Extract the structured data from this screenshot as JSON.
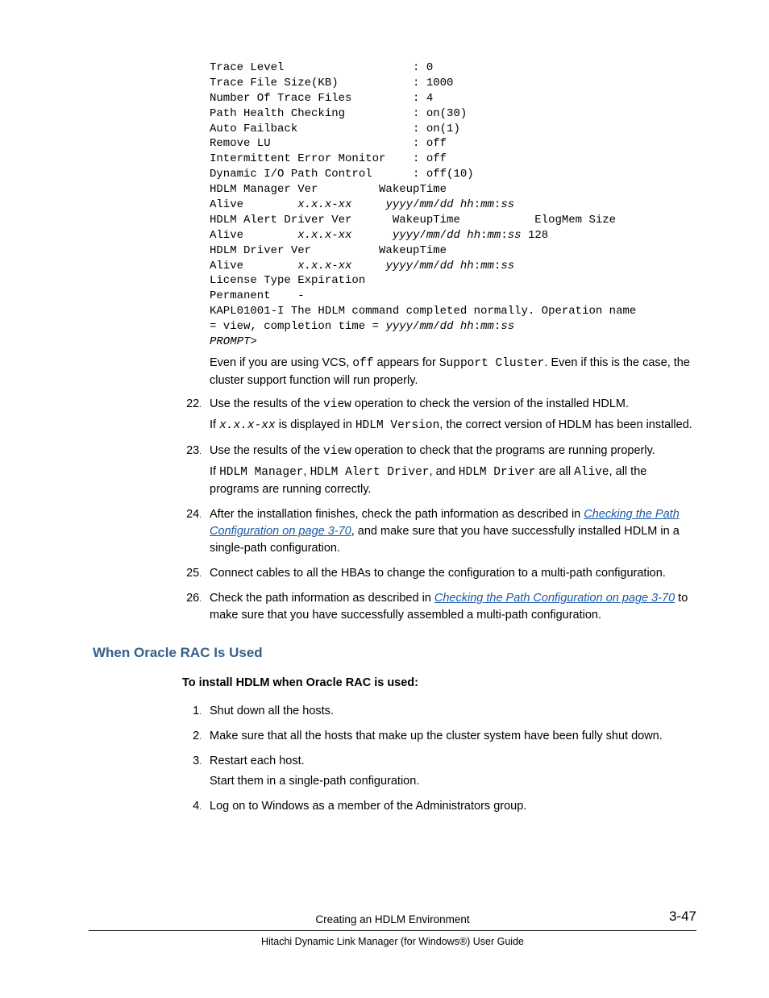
{
  "code": {
    "k0": "Trace Level                   : ",
    "v0": "0",
    "k1": "Trace File Size(KB)           : ",
    "v1": "1000",
    "k2": "Number Of Trace Files         : ",
    "v2": "4",
    "k3": "Path Health Checking          : ",
    "v3": "on(30)",
    "k4": "Auto Failback                 : ",
    "v4": "on(1)",
    "k5": "Remove LU                     : ",
    "v5": "off",
    "k6": "Intermittent Error Monitor    : ",
    "v6": "off",
    "k7": "Dynamic I/O Path Control      : ",
    "v7": "off(10)",
    "l8": "HDLM Manager Ver         WakeupTime",
    "a9a": "Alive        ",
    "a9b": "x.x.x-xx",
    "a9c": "     ",
    "a9d": "yyyy",
    "a9e": "/",
    "a9f": "mm",
    "a9g": "/",
    "a9h": "dd hh",
    "a9i": ":",
    "a9j": "mm",
    "a9k": ":",
    "a9l": "ss",
    "l10": "HDLM Alert Driver Ver      WakeupTime           ElogMem Size",
    "a11a": "Alive        ",
    "a11b": "x.x.x-xx",
    "a11c": "      ",
    "a11d": "yyyy",
    "a11e": "/",
    "a11f": "mm",
    "a11g": "/",
    "a11h": "dd hh",
    "a11i": ":",
    "a11j": "mm",
    "a11k": ":",
    "a11l": "ss",
    "a11m": " 128",
    "l12": "HDLM Driver Ver          WakeupTime",
    "a13a": "Alive        ",
    "a13b": "x.x.x-xx",
    "a13c": "     ",
    "a13d": "yyyy",
    "a13e": "/",
    "a13f": "mm",
    "a13g": "/",
    "a13h": "dd hh",
    "a13i": ":",
    "a13j": "mm",
    "a13k": ":",
    "a13l": "ss",
    "l14": "License Type Expiration",
    "l15": "Permanent    -",
    "l16a": "KAPL01001-I The HDLM command completed normally. Operation name ",
    "l16b": "= view, completion time = ",
    "l16c": "yyyy",
    "l16d": "/",
    "l16e": "mm",
    "l16f": "/",
    "l16g": "dd hh",
    "l16h": ":",
    "l16i": "mm",
    "l16j": ":",
    "l16k": "ss",
    "l17": "PROMPT",
    "l17b": ">"
  },
  "p_cluster_a": "Even if you are using VCS, ",
  "p_cluster_b": "off",
  "p_cluster_c": " appears for ",
  "p_cluster_d": "Support Cluster",
  "p_cluster_e": ". Even if this is the case, the cluster support function will run properly.",
  "steps": {
    "n22": "22",
    "s22a": "Use the results of the ",
    "s22b": "view",
    "s22c": " operation to check the version of the installed HDLM.",
    "s22d": "If ",
    "s22e": "x.x.x-xx",
    "s22f": " is displayed in ",
    "s22g": "HDLM Version",
    "s22h": ", the correct version of HDLM has been installed.",
    "n23": "23",
    "s23a": "Use the results of the ",
    "s23b": "view",
    "s23c": " operation to check that the programs are running properly.",
    "s23d": "If ",
    "s23e": "HDLM Manager",
    "s23f": ", ",
    "s23g": "HDLM Alert Driver",
    "s23h": ", and ",
    "s23i": "HDLM Driver",
    "s23j": " are all ",
    "s23k": "Alive",
    "s23l": ", all the programs are running correctly.",
    "n24": "24",
    "s24a": "After the installation finishes, check the path information as described in ",
    "s24link": "Checking the Path Configuration on page 3-70",
    "s24b": ", and make sure that you have successfully installed HDLM in a single-path configuration.",
    "n25": "25",
    "s25": "Connect cables to all the HBAs to change the configuration to a multi-path configuration.",
    "n26": "26",
    "s26a": "Check the path information as described in ",
    "s26link": "Checking the Path Configuration on page 3-70",
    "s26b": " to make sure that you have successfully assembled a multi-path configuration."
  },
  "heading": "When Oracle RAC Is Used",
  "subheading": "To install HDLM when Oracle RAC is used:",
  "rac": {
    "n1": "1",
    "s1": "Shut down all the hosts.",
    "n2": "2",
    "s2": "Make sure that all the hosts that make up the cluster system have been fully shut down.",
    "n3": "3",
    "s3a": "Restart each host.",
    "s3b": "Start them in a single-path configuration.",
    "n4": "4",
    "s4": "Log on to Windows as a member of the Administrators group."
  },
  "footer": {
    "chapter": "Creating an HDLM Environment",
    "guide": "Hitachi Dynamic Link Manager (for Windows®) User Guide",
    "page": "3-47"
  }
}
